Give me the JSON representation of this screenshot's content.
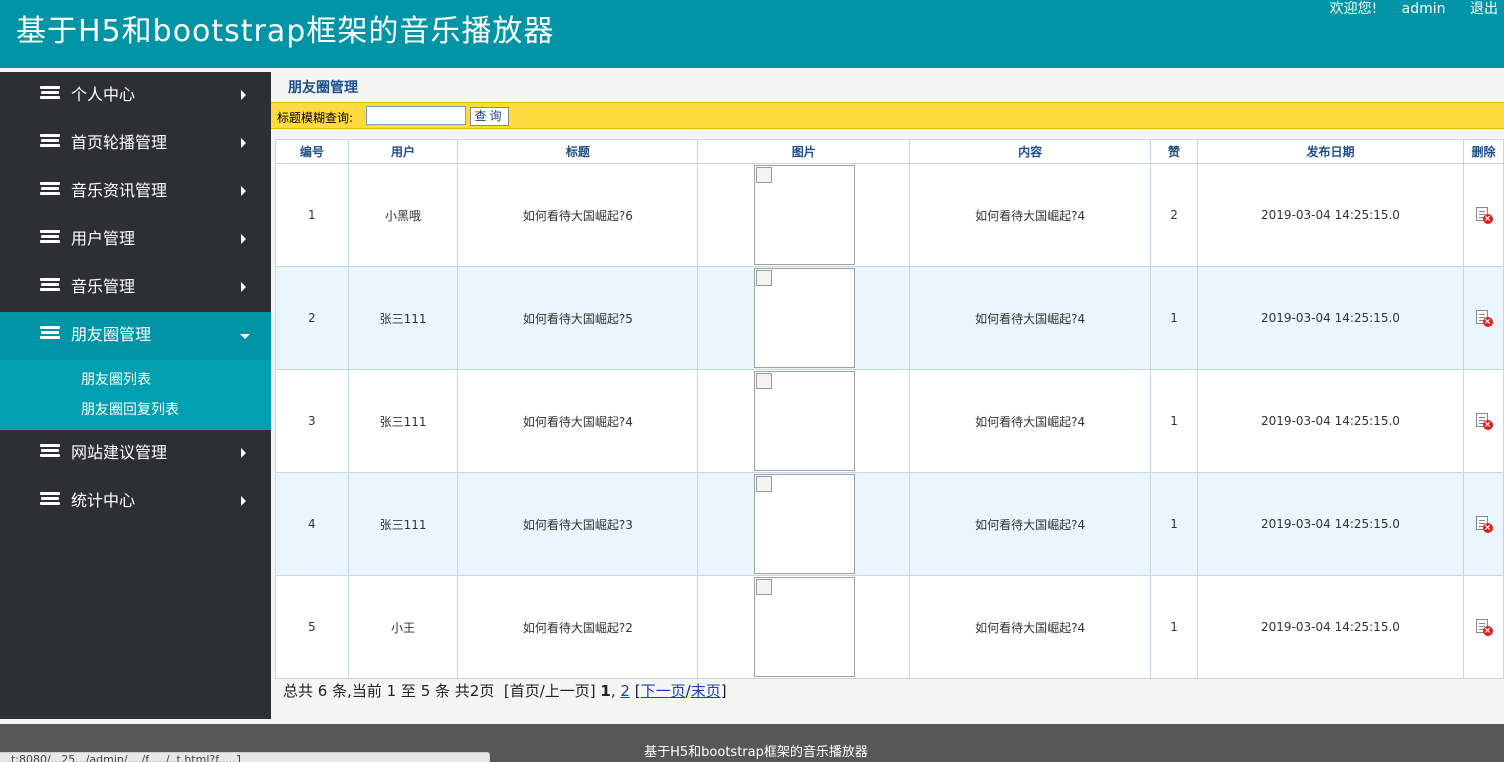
{
  "header": {
    "title": "基于H5和bootstrap框架的音乐播放器",
    "welcome": "欢迎您!",
    "username": "admin",
    "logout": "退出"
  },
  "sidebar": {
    "items": [
      {
        "label": "个人中心",
        "icon": "stack-icon"
      },
      {
        "label": "首页轮播管理",
        "icon": "stack-icon"
      },
      {
        "label": "音乐资讯管理",
        "icon": "stack-icon"
      },
      {
        "label": "用户管理",
        "icon": "stack-icon"
      },
      {
        "label": "音乐管理",
        "icon": "stack-icon"
      },
      {
        "label": "朋友圈管理",
        "icon": "stack-icon",
        "active": true
      },
      {
        "label": "网站建议管理",
        "icon": "stack-icon"
      },
      {
        "label": "统计中心",
        "icon": "stack-icon"
      }
    ],
    "submenu": [
      {
        "label": "朋友圈列表"
      },
      {
        "label": "朋友圈回复列表"
      }
    ]
  },
  "main": {
    "heading": "朋友圈管理",
    "search": {
      "label": "标题模糊查询:",
      "value": "",
      "button": "查询"
    },
    "table": {
      "headers": [
        "编号",
        "用户",
        "标题",
        "图片",
        "内容",
        "赞",
        "发布日期",
        "删除"
      ],
      "rows": [
        {
          "id": "1",
          "user": "小黑哦",
          "title": "如何看待大国崛起?6",
          "content": "如何看待大国崛起?4",
          "likes": "2",
          "date": "2019-03-04 14:25:15.0"
        },
        {
          "id": "2",
          "user": "张三111",
          "title": "如何看待大国崛起?5",
          "content": "如何看待大国崛起?4",
          "likes": "1",
          "date": "2019-03-04 14:25:15.0"
        },
        {
          "id": "3",
          "user": "张三111",
          "title": "如何看待大国崛起?4",
          "content": "如何看待大国崛起?4",
          "likes": "1",
          "date": "2019-03-04 14:25:15.0"
        },
        {
          "id": "4",
          "user": "张三111",
          "title": "如何看待大国崛起?3",
          "content": "如何看待大国崛起?4",
          "likes": "1",
          "date": "2019-03-04 14:25:15.0"
        },
        {
          "id": "5",
          "user": "小王",
          "title": "如何看待大国崛起?2",
          "content": "如何看待大国崛起?4",
          "likes": "1",
          "date": "2019-03-04 14:25:15.0"
        }
      ]
    },
    "pagination": {
      "summary": "总共 6 条,当前 1 至 5 条 共2页",
      "first_prev": "[首页/上一页]",
      "current_page": "1",
      "separator": ",",
      "page2": "2",
      "bracket_open": "[",
      "next": "下一页",
      "slash": "/",
      "last": "末页",
      "bracket_close": "]"
    }
  },
  "footer": {
    "text": "基于H5和bootstrap框架的音乐播放器"
  },
  "status_bar": {
    "url": "..t:8080/...25.../admin/..../f...../..t.html?f.....1"
  }
}
